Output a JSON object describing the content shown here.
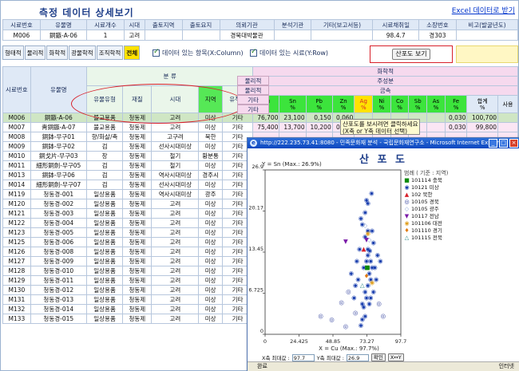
{
  "header": {
    "title": "측정 데이터 상세보기",
    "excel_link": "Excel 데이터로 받기"
  },
  "summary": {
    "headers": [
      "시료번호",
      "유물명",
      "시료개수",
      "시대",
      "출토지역",
      "출토요지",
      "의뢰기관",
      "분석기관",
      "기타(보고서등)",
      "시료채취일",
      "소장번호",
      "비고(발굴년도)"
    ],
    "values": [
      "M006",
      "銅鏃-A-06",
      "1",
      "고려",
      "",
      "",
      "경북대박물관",
      "",
      "",
      "98.4.7",
      "경303",
      ""
    ]
  },
  "tabs": [
    {
      "label": "형태적",
      "active": false
    },
    {
      "label": "물리적",
      "active": false
    },
    {
      "label": "화학적",
      "active": false
    },
    {
      "label": "광물학적",
      "active": false
    },
    {
      "label": "조직학적",
      "active": false
    },
    {
      "label": "전체",
      "active": true
    }
  ],
  "checkboxes": {
    "column": "데이터 있는 항목(X:Column)",
    "row": "데이터 있는 시료(Y:Row)"
  },
  "scatter_button": "산포도 보기",
  "grid": {
    "col_sample": "시료번호",
    "col_name": "유물명",
    "group_class": "분 류",
    "class_cols": [
      "유물유형",
      "재질",
      "시대",
      "지역",
      "유적지"
    ],
    "section_headers": [
      "물리적",
      "물리적",
      "기타",
      "기타"
    ],
    "chem_header": "화학적",
    "main_comp": "주성분",
    "metal": "금속",
    "elements": [
      {
        "sym": "Cu",
        "unit": "%"
      },
      {
        "sym": "Sn",
        "unit": "%"
      },
      {
        "sym": "Pb",
        "unit": "%"
      },
      {
        "sym": "Zn",
        "unit": "%"
      },
      {
        "sym": "Ag",
        "unit": "%"
      },
      {
        "sym": "Ni",
        "unit": "%"
      },
      {
        "sym": "Co",
        "unit": "%"
      },
      {
        "sym": "Sb",
        "unit": "%"
      },
      {
        "sym": "As",
        "unit": "%"
      },
      {
        "sym": "Fe",
        "unit": "%"
      },
      {
        "sym": "합계",
        "unit": "%"
      },
      {
        "sym": "사용",
        "unit": ""
      }
    ],
    "rows": [
      {
        "id": "M006",
        "name": "銅鏃-A-06",
        "type": "불교용품",
        "mat": "청동제",
        "era": "고려",
        "region": "미상",
        "site": "기타",
        "vals": [
          "76,700",
          "23,100",
          "0,150",
          "0,060",
          "",
          "",
          "",
          "",
          "",
          "0,030",
          "100,700"
        ]
      },
      {
        "id": "M007",
        "name": "靑銅鏃-A-07",
        "type": "불교용품",
        "mat": "청동제",
        "era": "고려",
        "region": "미상",
        "site": "기타",
        "vals": [
          "75,400",
          "13,700",
          "10,200",
          "0,060",
          "",
          "",
          "",
          "",
          "",
          "0,030",
          "99,800"
        ]
      },
      {
        "id": "M008",
        "name": "銅鉢-무구01",
        "type": "향/화살/촉",
        "mat": "청동제",
        "era": "고구려",
        "region": "북한",
        "site": "기타",
        "vals": []
      },
      {
        "id": "M009",
        "name": "銅鉢-무구02",
        "type": "검",
        "mat": "청동제",
        "era": "선사시대미상",
        "region": "미상",
        "site": "기타",
        "vals": []
      },
      {
        "id": "M010",
        "name": "銅戈片-무구03",
        "type": "창",
        "mat": "청동제",
        "era": "철기",
        "region": "황분통",
        "site": "기타",
        "vals": []
      },
      {
        "id": "M011",
        "name": "細形銅劍-무구05",
        "type": "검",
        "mat": "청동제",
        "era": "철기",
        "region": "미상",
        "site": "기타",
        "vals": []
      },
      {
        "id": "M013",
        "name": "銅鉢-무구06",
        "type": "검",
        "mat": "청동제",
        "era": "역사시대미상",
        "region": "경주시",
        "site": "기타",
        "vals": []
      },
      {
        "id": "M014",
        "name": "細形銅劍-무구07",
        "type": "검",
        "mat": "청동제",
        "era": "선사시대미상",
        "region": "미상",
        "site": "기타",
        "vals": []
      },
      {
        "id": "M119",
        "name": "청동경-001",
        "type": "일상용품",
        "mat": "청동제",
        "era": "역사시대미상",
        "region": "광주",
        "site": "기타",
        "vals": []
      },
      {
        "id": "M120",
        "name": "청동경-002",
        "type": "일상용품",
        "mat": "청동제",
        "era": "고려",
        "region": "미상",
        "site": "기타",
        "vals": []
      },
      {
        "id": "M121",
        "name": "청동경-003",
        "type": "일상용품",
        "mat": "청동제",
        "era": "고려",
        "region": "미상",
        "site": "기타",
        "vals": []
      },
      {
        "id": "M122",
        "name": "청동경-004",
        "type": "일상용품",
        "mat": "청동제",
        "era": "고려",
        "region": "미상",
        "site": "기타",
        "vals": []
      },
      {
        "id": "M123",
        "name": "청동경-005",
        "type": "일상용품",
        "mat": "청동제",
        "era": "고려",
        "region": "미상",
        "site": "기타",
        "vals": []
      },
      {
        "id": "M125",
        "name": "청동경-006",
        "type": "일상용품",
        "mat": "청동제",
        "era": "고려",
        "region": "미상",
        "site": "기타",
        "vals": []
      },
      {
        "id": "M126",
        "name": "청동경-008",
        "type": "일상용품",
        "mat": "청동제",
        "era": "고려",
        "region": "미상",
        "site": "기타",
        "vals": []
      },
      {
        "id": "M127",
        "name": "청동경-009",
        "type": "일상용품",
        "mat": "청동제",
        "era": "고려",
        "region": "미상",
        "site": "기타",
        "vals": []
      },
      {
        "id": "M128",
        "name": "청동경-010",
        "type": "일상용품",
        "mat": "청동제",
        "era": "고려",
        "region": "미상",
        "site": "기타",
        "vals": []
      },
      {
        "id": "M129",
        "name": "청동경-011",
        "type": "일상용품",
        "mat": "청동제",
        "era": "고려",
        "region": "미상",
        "site": "기타",
        "vals": []
      },
      {
        "id": "M130",
        "name": "청동경-012",
        "type": "일상용품",
        "mat": "청동제",
        "era": "고려",
        "region": "미상",
        "site": "기타",
        "vals": []
      },
      {
        "id": "M131",
        "name": "청동경-013",
        "type": "일상용품",
        "mat": "청동제",
        "era": "고려",
        "region": "미상",
        "site": "기타",
        "vals": []
      },
      {
        "id": "M132",
        "name": "청동경-014",
        "type": "일상용품",
        "mat": "청동제",
        "era": "고려",
        "region": "미상",
        "site": "기타",
        "vals": []
      },
      {
        "id": "M133",
        "name": "청동경-015",
        "type": "일상용품",
        "mat": "청동제",
        "era": "고려",
        "region": "미상",
        "site": "기타",
        "vals": []
      }
    ]
  },
  "tooltip": {
    "line1": "산포도를 보시려면 클릭하세요",
    "line2": "(X축 or Y축 데이터 선택)"
  },
  "popup": {
    "window_title": "http://222.235.73.41:8080 - 민족문화재 분석 - 국립문화재연구소 - Microsoft Internet Explorer",
    "title": "산 포 도",
    "status_left": "완료",
    "status_right": "인터넷",
    "x_max_label": "X축 최대값 :",
    "x_max_value": "97.7",
    "y_max_label": "Y축 최대값 :",
    "y_max_value": "26.9",
    "btn_ok": "확인",
    "btn_swap": "X↔Y",
    "legend_title": "범례 ( 기준 : 지역)",
    "legend": [
      {
        "label": "101114 충북",
        "symbol": "■",
        "color": "#0a8a0a"
      },
      {
        "label": "10121 미상",
        "symbol": "◉",
        "color": "#1a3fae"
      },
      {
        "label": "102 북한",
        "symbol": "▲",
        "color": "#d8202a"
      },
      {
        "label": "10105 경북",
        "symbol": "◎",
        "color": "#2a3a9a"
      },
      {
        "label": "10105 광주",
        "symbol": "◇",
        "color": "#8aa3d8"
      },
      {
        "label": "10117 전남",
        "symbol": "▼",
        "color": "#7a1aa8"
      },
      {
        "label": "101106 대전",
        "symbol": "◉",
        "color": "#e0a020"
      },
      {
        "label": "101110 경기",
        "symbol": "♦",
        "color": "#e07a10"
      },
      {
        "label": "101115 전북",
        "symbol": "△",
        "color": "#2a8a8a"
      }
    ]
  },
  "chart_data": {
    "type": "scatter",
    "title": "산 포 도",
    "xlabel": "X = Cu (Max.: 97.7%)",
    "ylabel": "Y = Sn (Max.: 26.9%)",
    "xlim": [
      0,
      97.7
    ],
    "ylim": [
      0,
      26.9
    ],
    "x_ticks": [
      "0",
      "24.425",
      "48.85",
      "73.27",
      "97.7"
    ],
    "y_ticks": [
      "0",
      "6.725",
      "13.45",
      "20.17",
      "26.9"
    ],
    "series": [
      {
        "name": "10121 미상",
        "color": "#1a3fae",
        "symbol": "◉",
        "points": [
          [
            76.7,
            23.1
          ],
          [
            75.4,
            13.7
          ],
          [
            70,
            18
          ],
          [
            72,
            16
          ],
          [
            74,
            14
          ],
          [
            73,
            12
          ],
          [
            71,
            11
          ],
          [
            75,
            10
          ],
          [
            76,
            9
          ],
          [
            74,
            8
          ],
          [
            72,
            7
          ],
          [
            73,
            6
          ],
          [
            70,
            5
          ],
          [
            71,
            4.5
          ],
          [
            74,
            13
          ],
          [
            78,
            15
          ],
          [
            77,
            17
          ],
          [
            69,
            19
          ],
          [
            72,
            20
          ],
          [
            74,
            21.5
          ],
          [
            73,
            22
          ],
          [
            68,
            14
          ],
          [
            66,
            12
          ],
          [
            67,
            9
          ],
          [
            65,
            8
          ],
          [
            79,
            11
          ],
          [
            80,
            9
          ],
          [
            78,
            7
          ],
          [
            76,
            6
          ],
          [
            75,
            5
          ],
          [
            72,
            3
          ],
          [
            70,
            2.5
          ],
          [
            69,
            1.5
          ],
          [
            64,
            6
          ],
          [
            62,
            10
          ],
          [
            81,
            13
          ],
          [
            83,
            12
          ],
          [
            76,
            12
          ],
          [
            77,
            11
          ],
          [
            74,
            17
          ]
        ]
      },
      {
        "name": "10105 경북",
        "color": "#2a3a9a",
        "symbol": "◎",
        "points": [
          [
            40,
            3
          ],
          [
            55,
            5.2
          ],
          [
            48,
            2.4
          ],
          [
            65,
            3.5
          ],
          [
            82,
            5
          ],
          [
            85,
            3
          ],
          [
            60,
            7
          ],
          [
            58,
            1.3
          ]
        ]
      },
      {
        "name": "102 북한",
        "color": "#d8202a",
        "symbol": "▲",
        "points": [
          [
            71,
            14
          ]
        ]
      },
      {
        "name": "101114 충북",
        "color": "#0a8a0a",
        "symbol": "■",
        "points": [
          [
            73.5,
            11
          ]
        ]
      },
      {
        "name": "10117 전남",
        "color": "#7a1aa8",
        "symbol": "▼",
        "points": [
          [
            58,
            15.2
          ],
          [
            73,
            15.5
          ]
        ]
      },
      {
        "name": "101106 대전",
        "color": "#e0a020",
        "symbol": "◉",
        "points": [
          [
            74,
            16.5
          ],
          [
            77,
            8.5
          ]
        ]
      },
      {
        "name": "101115 전북",
        "color": "#2a8a8a",
        "symbol": "△",
        "points": [
          [
            70,
            8
          ]
        ]
      },
      {
        "name": "10105 광주",
        "color": "#8aa3d8",
        "symbol": "◇",
        "points": [
          [
            72,
            17.8
          ],
          [
            75,
            15.5
          ]
        ]
      },
      {
        "name": "101110 경기",
        "color": "#e07a10",
        "symbol": "♦",
        "points": [
          [
            73,
            9.5
          ]
        ]
      }
    ]
  }
}
